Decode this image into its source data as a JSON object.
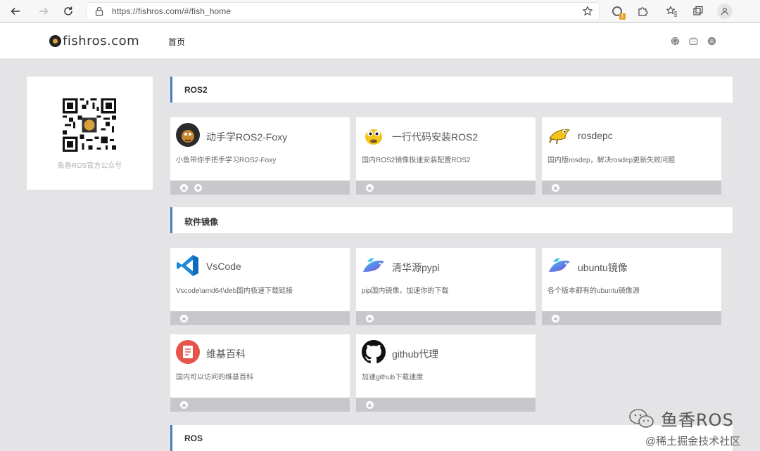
{
  "browser": {
    "url": "https://fishros.com/#/fish_home",
    "extension_badge": "1"
  },
  "header": {
    "logo_text": "fishros.com",
    "nav_home": "首页",
    "icons": [
      "github-icon",
      "bilibili-icon",
      "menu-icon"
    ]
  },
  "sidebar": {
    "qr_caption": "鱼香ROS官方公众号"
  },
  "sections": [
    {
      "title": "ROS2"
    },
    {
      "title": "软件镜像"
    },
    {
      "title": "ROS"
    }
  ],
  "cards": [
    {
      "title": "动手学ROS2-Foxy",
      "desc": "小鱼带你手把手学习ROS2-Foxy",
      "icon": "avatar-icon",
      "links": [
        "home-link",
        "github-link"
      ]
    },
    {
      "title": "一行代码安装ROS2",
      "desc": "国内ROS2镜像极速安装配置ROS2",
      "icon": "turtle-icon",
      "links": [
        "home-link"
      ]
    },
    {
      "title": "rosdepc",
      "desc": "国内版rosdep，解决rosdep更新失败问题",
      "icon": "ros-turtle-icon",
      "links": [
        "home-link"
      ]
    },
    {
      "title": "VsCode",
      "desc": "Vscode\\amd64\\deb国内极速下载链接",
      "icon": "vscode-icon",
      "links": [
        "home-link"
      ]
    },
    {
      "title": "清华源pypi",
      "desc": "pip国内镜像，加速你的下载",
      "icon": "fish-icon",
      "links": [
        "home-link"
      ]
    },
    {
      "title": "ubuntu镜像",
      "desc": "各个版本都有的ubuntu镜像源",
      "icon": "fish-icon",
      "links": [
        "home-link"
      ]
    },
    {
      "title": "维基百科",
      "desc": "国内可以访问的维基百科",
      "icon": "wiki-icon",
      "links": [
        "home-link"
      ]
    },
    {
      "title": "github代理",
      "desc": "加速github下载速度",
      "icon": "github-icon",
      "links": [
        "home-link"
      ]
    }
  ],
  "watermark": {
    "brand": "鱼香ROS",
    "community": "@稀土掘金技术社区"
  },
  "colors": {
    "page_bg": "#e4e4e6",
    "section_accent": "#4a7fb5",
    "card_footer": "#c7c7cc"
  }
}
